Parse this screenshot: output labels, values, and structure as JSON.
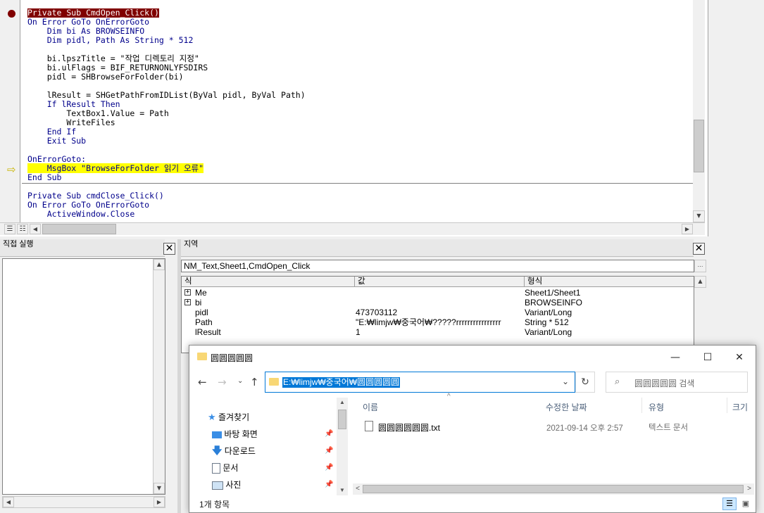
{
  "code": {
    "lines": [
      "Private Sub CmdOpen_Click()",
      "On Error GoTo OnErrorGoto",
      "    Dim bi As BROWSEINFO",
      "    Dim pidl, Path As String * 512",
      "",
      "    bi.lpszTitle = \"작업 디렉토리 지정\"",
      "    bi.ulFlags = BIF_RETURNONLYFSDIRS",
      "    pidl = SHBrowseForFolder(bi)",
      "",
      "    lResult = SHGetPathFromIDList(ByVal pidl, ByVal Path)",
      "    If lResult Then",
      "        TextBox1.Value = Path",
      "        WriteFiles",
      "    End If",
      "    Exit Sub",
      "",
      "OnErrorGoto:",
      "    MsgBox \"BrowseForFolder 읽기 오류\"",
      "End Sub",
      "",
      "Private Sub cmdClose_Click()",
      "On Error GoTo OnErrorGoto",
      "    ActiveWindow.Close"
    ]
  },
  "immediate": {
    "title": "직접 실행"
  },
  "locals": {
    "title": "지역",
    "context": "NM_Text,Sheet1,CmdOpen_Click",
    "columns": [
      "식",
      "값",
      "형식"
    ],
    "rows": [
      {
        "expr": "Me",
        "value": "",
        "type": "Sheet1/Sheet1",
        "expandable": true
      },
      {
        "expr": "bi",
        "value": "",
        "type": "BROWSEINFO",
        "expandable": true
      },
      {
        "expr": "pidl",
        "value": "473703112",
        "type": "Variant/Long",
        "expandable": false
      },
      {
        "expr": "Path",
        "value": "\"E:₩limjw₩중국어₩?????rrrrrrrrrrrrrrrr",
        "type": "String * 512",
        "expandable": false
      },
      {
        "expr": "lResult",
        "value": "1",
        "type": "Variant/Long",
        "expandable": false
      }
    ]
  },
  "explorer": {
    "title": "圆圆圆圆圆",
    "address": "E:₩limjw₩중국어₩圆圆圆圆圆",
    "search_placeholder": "圆圆圆圆圆 검색",
    "nav": [
      {
        "label": "즐겨찾기",
        "icon": "star-icon",
        "pinned": false
      },
      {
        "label": "바탕 화면",
        "icon": "desktop-icon",
        "pinned": true
      },
      {
        "label": "다운로드",
        "icon": "download-icon",
        "pinned": true
      },
      {
        "label": "문서",
        "icon": "document-icon",
        "pinned": true
      },
      {
        "label": "사진",
        "icon": "picture-icon",
        "pinned": true
      }
    ],
    "columns": [
      "이름",
      "수정한 날짜",
      "유형",
      "크기"
    ],
    "files": [
      {
        "name": "圆圆圆圆圆圆.txt",
        "modified": "2021-09-14 오후 2:57",
        "type": "텍스트 문서"
      }
    ],
    "status": "1개 항목",
    "colors": {
      "accent": "#0078d7",
      "folder": "#f8d775"
    }
  }
}
